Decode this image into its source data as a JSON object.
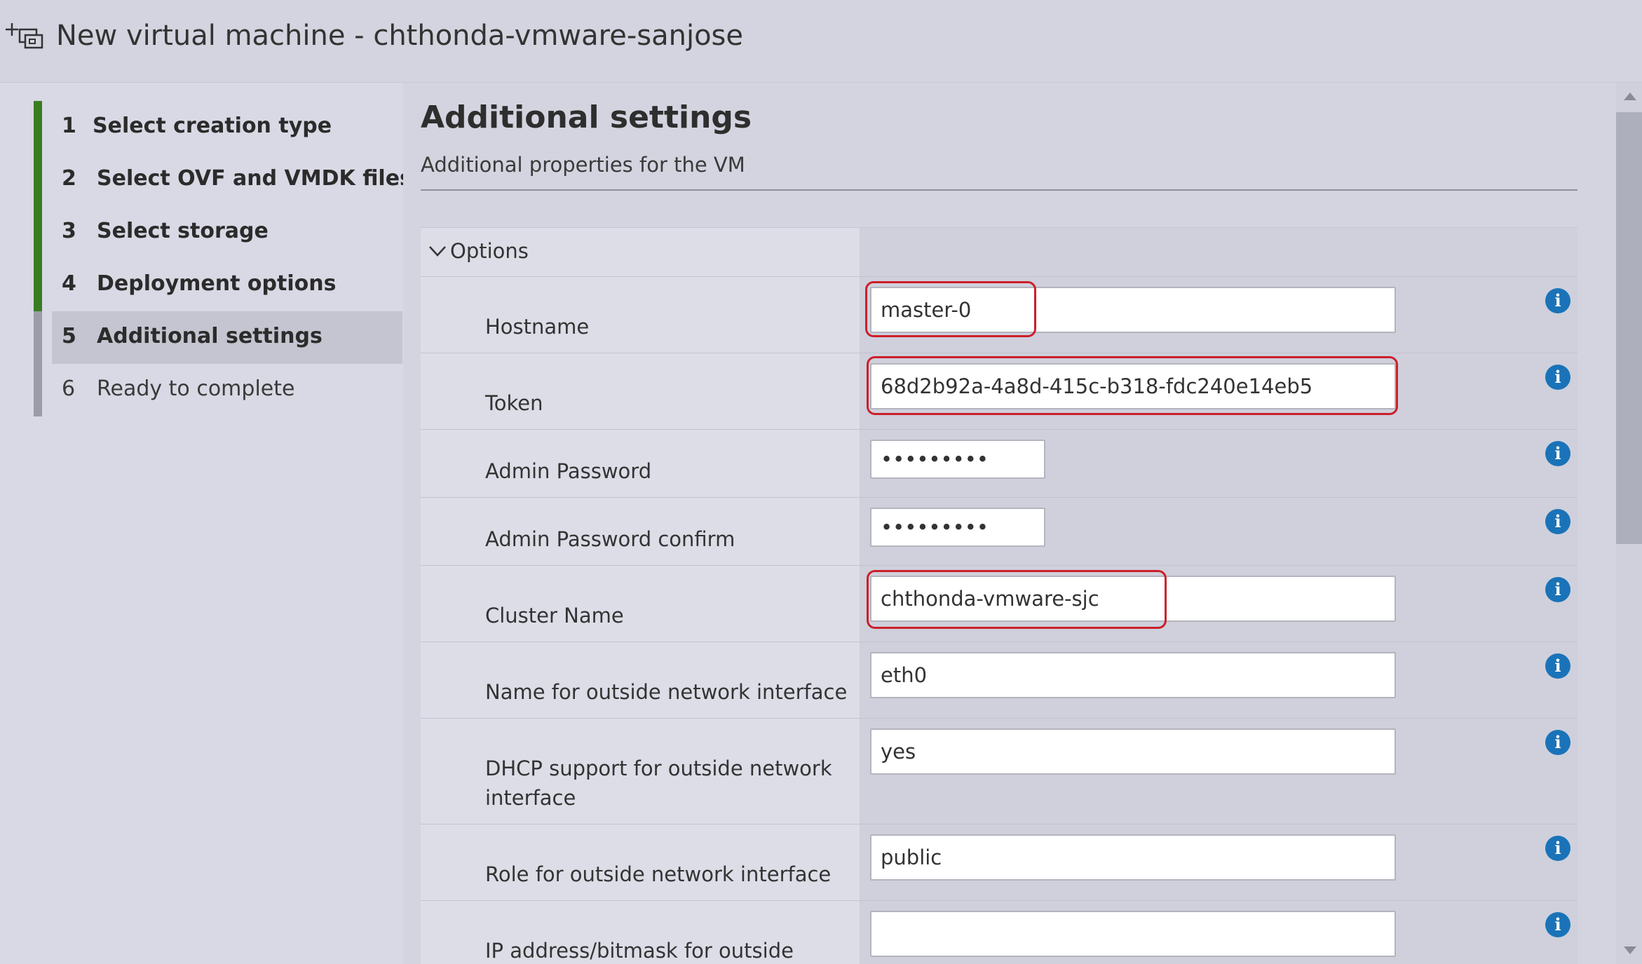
{
  "window": {
    "title": "New virtual machine - chthonda-vmware-sanjose",
    "icon": "new-vm-icon"
  },
  "sidebar": {
    "steps": [
      {
        "num": "1",
        "label": "Select creation type",
        "state": "completed"
      },
      {
        "num": "2",
        "label": "Select OVF and VMDK files",
        "state": "completed"
      },
      {
        "num": "3",
        "label": "Select storage",
        "state": "completed"
      },
      {
        "num": "4",
        "label": "Deployment options",
        "state": "completed"
      },
      {
        "num": "5",
        "label": "Additional settings",
        "state": "active"
      },
      {
        "num": "6",
        "label": "Ready to complete",
        "state": "pending"
      }
    ]
  },
  "main": {
    "title": "Additional settings",
    "subtitle": "Additional properties for the VM",
    "section": {
      "label": "Options",
      "expanded": true
    },
    "fields": [
      {
        "label": "Hostname",
        "value": "master-0",
        "type": "text"
      },
      {
        "label": "Token",
        "value": "68d2b92a-4a8d-415c-b318-fdc240e14eb5",
        "type": "text"
      },
      {
        "label": "Admin Password",
        "value": "•••••••••",
        "type": "password"
      },
      {
        "label": "Admin Password confirm",
        "value": "•••••••••",
        "type": "password"
      },
      {
        "label": "Cluster Name",
        "value": "chthonda-vmware-sjc",
        "type": "text"
      },
      {
        "label": "Name for outside network interface",
        "value": "eth0",
        "type": "text"
      },
      {
        "label": "DHCP support for outside network interface",
        "value": "yes",
        "type": "text"
      },
      {
        "label": "Role for outside network interface",
        "value": "public",
        "type": "text"
      },
      {
        "label": "IP address/bitmask for outside",
        "value": "",
        "type": "text"
      }
    ]
  },
  "colors": {
    "completed_bar": "#3a7d21",
    "pending_bar": "#9b9ca6",
    "highlight": "#cc1f2a",
    "info": "#1a73b8"
  },
  "icons": {
    "info": "i"
  }
}
